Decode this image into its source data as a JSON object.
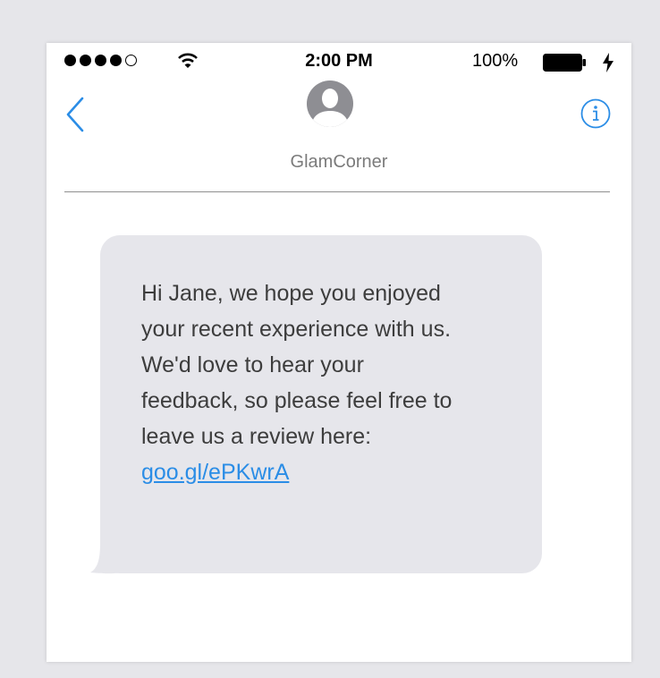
{
  "status_bar": {
    "time": "2:00 PM",
    "battery_percent": "100%",
    "signal_bars_filled": 4,
    "signal_bars_total": 5
  },
  "header": {
    "contact_name": "GlamCorner"
  },
  "message": {
    "lines": [
      "Hi Jane, we hope you enjoyed",
      "your recent experience with us.",
      "We'd love to hear your",
      "feedback, so please feel free to",
      "leave us a review here:"
    ],
    "link_text": "goo.gl/ePKwrA"
  },
  "colors": {
    "accent": "#2b8de6",
    "bubble": "#e6e6eb",
    "contact_name": "#7b7b7b",
    "message_text": "#3d3d3d"
  },
  "icons": {
    "back": "chevron-left-icon",
    "info": "info-icon",
    "avatar": "person-silhouette-icon",
    "wifi": "wifi-icon",
    "battery": "battery-icon",
    "charging": "lightning-bolt-icon"
  }
}
